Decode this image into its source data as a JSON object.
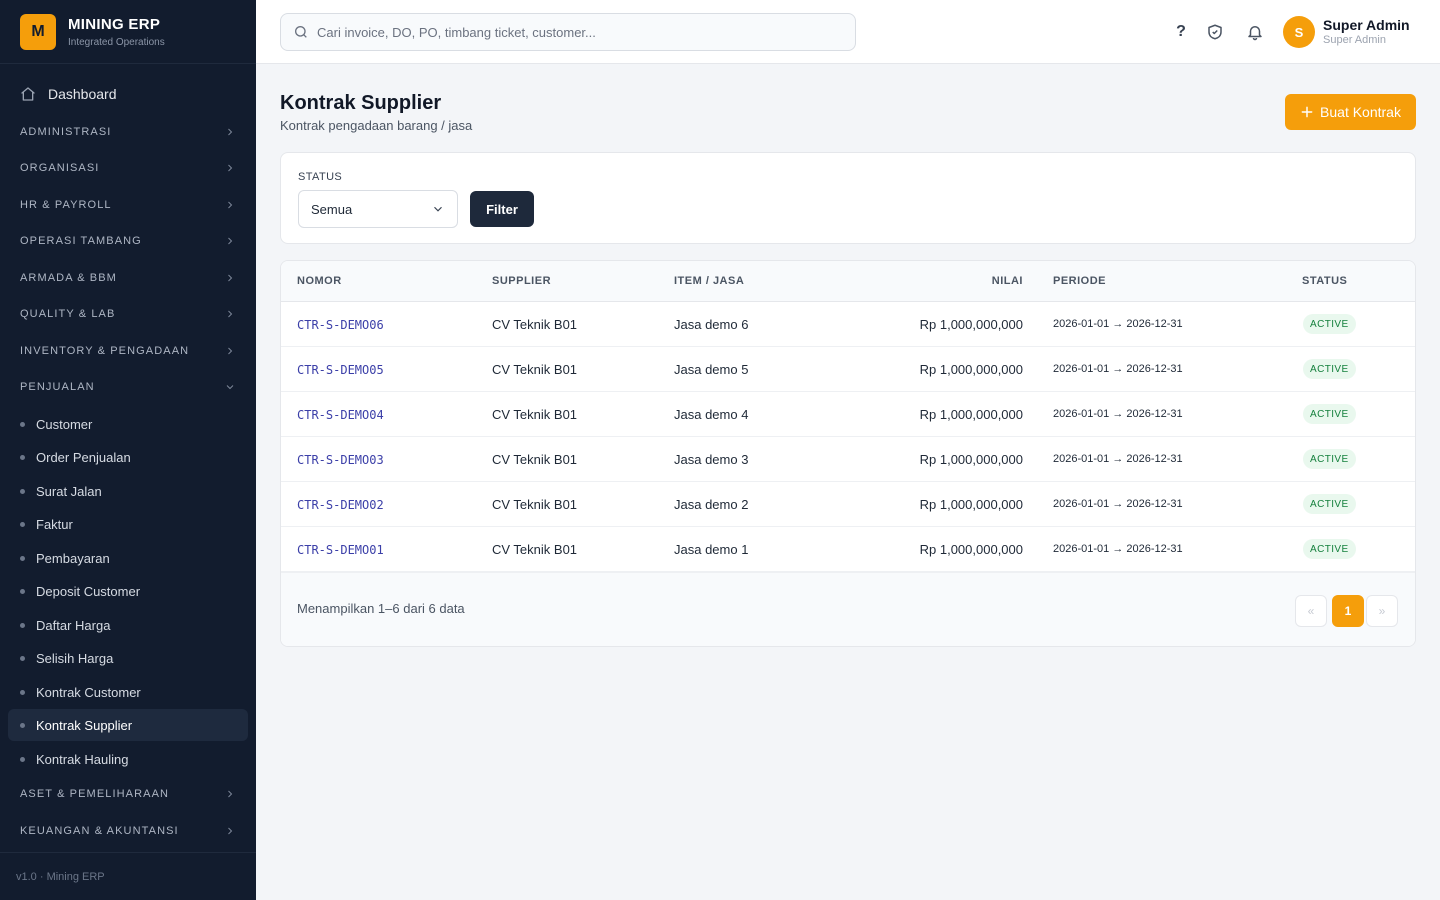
{
  "brand": {
    "logo": "M",
    "title": "MINING ERP",
    "subtitle": "Integrated Operations"
  },
  "sidebar": {
    "dashboard": "Dashboard",
    "sections": {
      "administrasi": "ADMINISTRASI",
      "organisasi": "ORGANISASI",
      "hr": "HR & PAYROLL",
      "operasi": "OPERASI TAMBANG",
      "armada": "ARMADA & BBM",
      "quality": "QUALITY & LAB",
      "inventory": "INVENTORY & PENGADAAN",
      "penjualan": "PENJUALAN",
      "aset": "ASET & PEMELIHARAAN",
      "keuangan": "KEUANGAN & AKUNTANSI"
    },
    "penjualan_items": [
      "Customer",
      "Order Penjualan",
      "Surat Jalan",
      "Faktur",
      "Pembayaran",
      "Deposit Customer",
      "Daftar Harga",
      "Selisih Harga",
      "Kontrak Customer",
      "Kontrak Supplier",
      "Kontrak Hauling"
    ],
    "active_item": "Kontrak Supplier",
    "footer": "v1.0 · Mining ERP"
  },
  "topbar": {
    "search_placeholder": "Cari invoice, DO, PO, timbang ticket, customer...",
    "help": "?",
    "user": {
      "initial": "S",
      "name": "Super Admin",
      "role": "Super Admin"
    }
  },
  "page": {
    "title": "Kontrak Supplier",
    "subtitle": "Kontrak pengadaan barang / jasa",
    "create_label": "Buat Kontrak"
  },
  "filter": {
    "label": "STATUS",
    "selected": "Semua",
    "button": "Filter"
  },
  "table": {
    "headers": {
      "nomor": "NOMOR",
      "supplier": "SUPPLIER",
      "item": "ITEM / JASA",
      "nilai": "NILAI",
      "periode": "PERIODE",
      "status": "STATUS"
    },
    "rows": [
      {
        "nomor": "CTR-S-DEMO06",
        "supplier": "CV Teknik B01",
        "item": "Jasa demo 6",
        "nilai": "Rp 1,000,000,000",
        "periode": "2026-01-01 → 2026-12-31",
        "status": "ACTIVE"
      },
      {
        "nomor": "CTR-S-DEMO05",
        "supplier": "CV Teknik B01",
        "item": "Jasa demo 5",
        "nilai": "Rp 1,000,000,000",
        "periode": "2026-01-01 → 2026-12-31",
        "status": "ACTIVE"
      },
      {
        "nomor": "CTR-S-DEMO04",
        "supplier": "CV Teknik B01",
        "item": "Jasa demo 4",
        "nilai": "Rp 1,000,000,000",
        "periode": "2026-01-01 → 2026-12-31",
        "status": "ACTIVE"
      },
      {
        "nomor": "CTR-S-DEMO03",
        "supplier": "CV Teknik B01",
        "item": "Jasa demo 3",
        "nilai": "Rp 1,000,000,000",
        "periode": "2026-01-01 → 2026-12-31",
        "status": "ACTIVE"
      },
      {
        "nomor": "CTR-S-DEMO02",
        "supplier": "CV Teknik B01",
        "item": "Jasa demo 2",
        "nilai": "Rp 1,000,000,000",
        "periode": "2026-01-01 → 2026-12-31",
        "status": "ACTIVE"
      },
      {
        "nomor": "CTR-S-DEMO01",
        "supplier": "CV Teknik B01",
        "item": "Jasa demo 1",
        "nilai": "Rp 1,000,000,000",
        "periode": "2026-01-01 → 2026-12-31",
        "status": "ACTIVE"
      }
    ],
    "footer_text": "Menampilkan 1–6 dari 6 data",
    "pagination": {
      "prev": "«",
      "current": "1",
      "next": "»"
    }
  },
  "colors": {
    "accent": "#f59e0b",
    "sidebar_bg": "#121c2e",
    "status_active": "#15803d"
  },
  "icons": [
    "home-icon",
    "chevron-right-icon",
    "chevron-down-icon",
    "search-icon",
    "help-icon",
    "shield-check-icon",
    "bell-icon",
    "plus-icon"
  ]
}
